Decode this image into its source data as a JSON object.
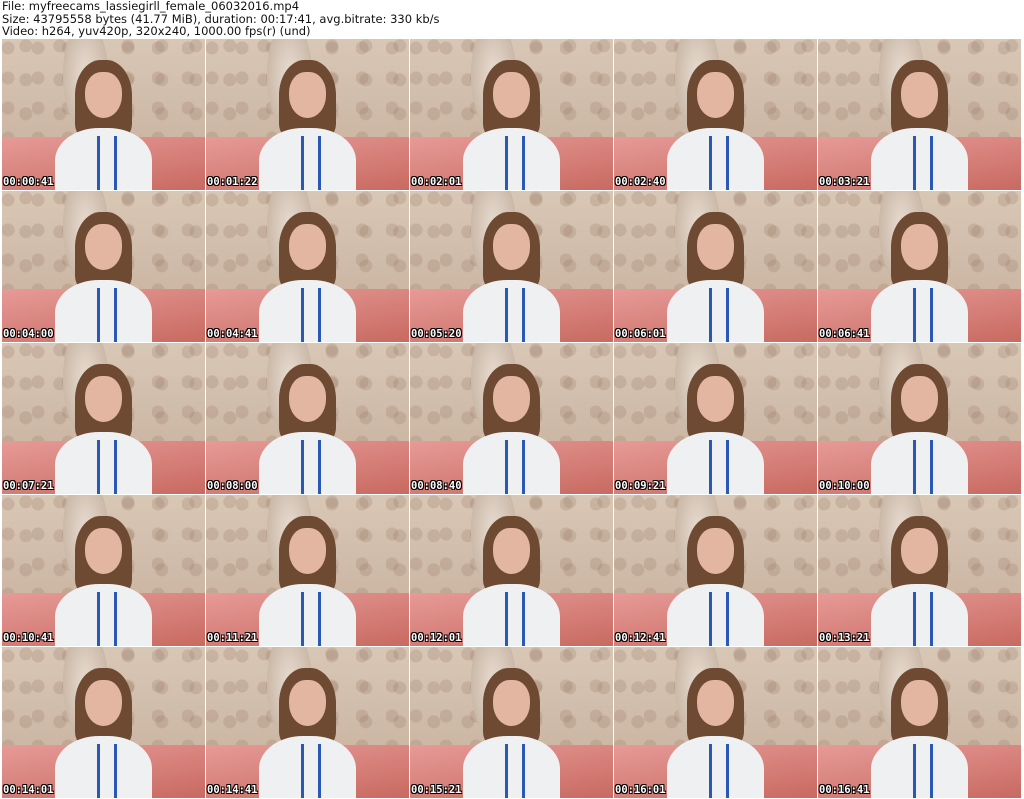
{
  "header": {
    "file_line": "File: myfreecams_lassiegirll_female_06032016.mp4",
    "size_line": "Size: 43795558 bytes (41.77 MiB), duration: 00:17:41, avg.bitrate: 330 kb/s",
    "video_line": "Video: h264, yuv420p, 320x240, 1000.00 fps(r) (und)"
  },
  "thumbnails": [
    {
      "timestamp": "00:00:41"
    },
    {
      "timestamp": "00:01:22"
    },
    {
      "timestamp": "00:02:01"
    },
    {
      "timestamp": "00:02:40"
    },
    {
      "timestamp": "00:03:21"
    },
    {
      "timestamp": "00:04:00"
    },
    {
      "timestamp": "00:04:41"
    },
    {
      "timestamp": "00:05:20"
    },
    {
      "timestamp": "00:06:01"
    },
    {
      "timestamp": "00:06:41"
    },
    {
      "timestamp": "00:07:21"
    },
    {
      "timestamp": "00:08:00"
    },
    {
      "timestamp": "00:08:40"
    },
    {
      "timestamp": "00:09:21"
    },
    {
      "timestamp": "00:10:00"
    },
    {
      "timestamp": "00:10:41"
    },
    {
      "timestamp": "00:11:21"
    },
    {
      "timestamp": "00:12:01"
    },
    {
      "timestamp": "00:12:41"
    },
    {
      "timestamp": "00:13:21"
    },
    {
      "timestamp": "00:14:01"
    },
    {
      "timestamp": "00:14:41"
    },
    {
      "timestamp": "00:15:21"
    },
    {
      "timestamp": "00:16:01"
    },
    {
      "timestamp": "00:16:41"
    }
  ]
}
